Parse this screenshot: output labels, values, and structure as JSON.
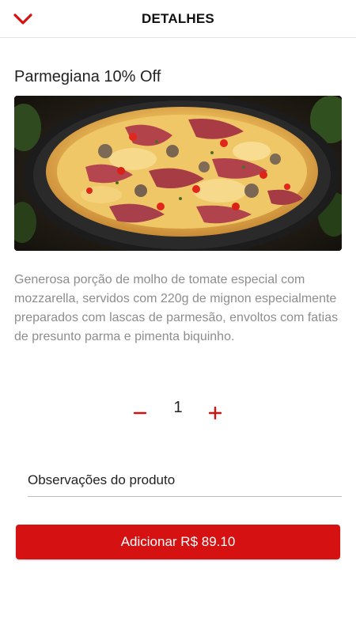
{
  "header": {
    "title": "DETALHES",
    "back_icon": "chevron-down-icon"
  },
  "product": {
    "name": "Parmegiana 10% Off",
    "image": "pizza-photo",
    "description": "Generosa porção de molho de tomate especial com mozzarella, servidos com 220g de mignon especialmente preparados com lascas de parmesão, envoltos com fatias de presunto parma e pimenta biquinho."
  },
  "quantity": {
    "value": "1",
    "decrement_icon": "minus-icon",
    "increment_icon": "plus-icon"
  },
  "notes": {
    "placeholder": "Observações do produto"
  },
  "cart": {
    "add_label": "Adicionar",
    "price": "R$ 89.10",
    "button_text": "Adicionar R$ 89.10"
  },
  "colors": {
    "accent": "#d51111",
    "text": "#222222",
    "muted": "#8d8d8d"
  }
}
